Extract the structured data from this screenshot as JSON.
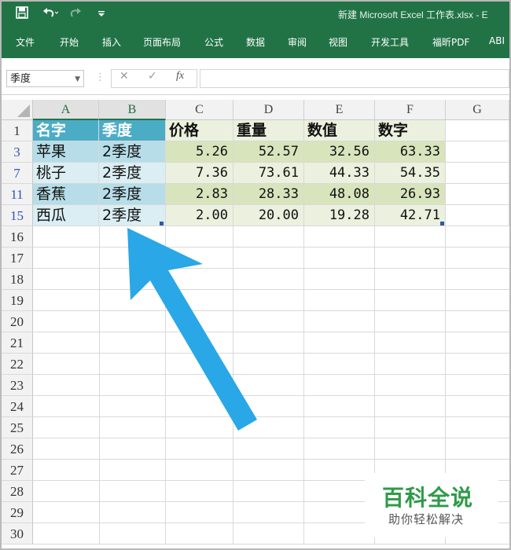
{
  "title_bar": {
    "document_title": "新建 Microsoft Excel 工作表.xlsx  -  E",
    "save_icon": "save-icon",
    "undo_icon": "undo-icon",
    "redo_icon": "redo-icon",
    "customize_icon": "customize-icon"
  },
  "ribbon": {
    "tabs": [
      "文件",
      "开始",
      "插入",
      "页面布局",
      "公式",
      "数据",
      "审阅",
      "视图",
      "开发工具",
      "福昕PDF",
      "ABI"
    ]
  },
  "formula_bar": {
    "name_box": "季度",
    "cancel_glyph": "✕",
    "enter_glyph": "✓",
    "fx_glyph": "fx",
    "formula_value": ""
  },
  "sheet": {
    "columns": [
      "A",
      "B",
      "C",
      "D",
      "E",
      "F",
      "G"
    ],
    "visible_rows": [
      "1",
      "3",
      "7",
      "11",
      "15",
      "16",
      "17",
      "18",
      "19",
      "20",
      "21",
      "22",
      "23",
      "24",
      "25",
      "26",
      "27",
      "28",
      "29",
      "30"
    ],
    "header_row": [
      "名字",
      "季度",
      "价格",
      "重量",
      "数值",
      "数字"
    ],
    "data_rows": [
      [
        "苹果",
        "2季度",
        "5.26",
        "52.57",
        "32.56",
        "63.33"
      ],
      [
        "桃子",
        "2季度",
        "7.36",
        "73.61",
        "44.33",
        "54.35"
      ],
      [
        "香蕉",
        "2季度",
        "2.83",
        "28.33",
        "48.08",
        "26.93"
      ],
      [
        "西瓜",
        "2季度",
        "2.00",
        "20.00",
        "19.28",
        "42.71"
      ]
    ]
  },
  "colors": {
    "excel_green": "#217346",
    "header_blue": "#4bacc6",
    "band_blue_dark": "#b6dde8",
    "band_blue_light": "#daeef3",
    "band_green_dark": "#d8e4bc",
    "band_green_light": "#ebf1de",
    "arrow_blue": "#2aa7e6",
    "watermark_green": "#2f9a4a"
  },
  "watermark": {
    "brand": "百科全说",
    "tagline": "助你轻松解决"
  }
}
